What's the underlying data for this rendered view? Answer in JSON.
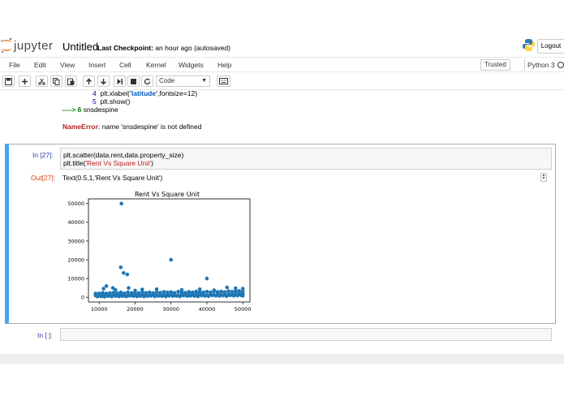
{
  "header": {
    "logo_text": "jupyter",
    "notebook_title": "Untitled",
    "checkpoint_label": "Last Checkpoint:",
    "checkpoint_time": "an hour ago",
    "autosave": "(autosaved)",
    "logout_label": "Logout"
  },
  "menubar": {
    "items": [
      "File",
      "Edit",
      "View",
      "Insert",
      "Cell",
      "Kernel",
      "Widgets",
      "Help"
    ],
    "trusted_label": "Trusted",
    "kernel_name": "Python 3"
  },
  "toolbar": {
    "cell_type": "Code",
    "icons": [
      "save-icon",
      "plus-icon",
      "cut-icon",
      "copy-icon",
      "paste-icon",
      "arrow-up-icon",
      "arrow-down-icon",
      "step-forward-icon",
      "stop-icon",
      "refresh-icon",
      "keyboard-icon"
    ]
  },
  "prev_output": {
    "line4_no": "4",
    "line4_pre": "plt.xlabel(",
    "line4_str": "'latitude'",
    "line4_post": ",fontsize=12)",
    "line5_no": "5",
    "line5_code": "plt.show()",
    "arrow_line_marker": "----> 6",
    "arrow_line_code": "snsdespine",
    "error_name": "NameError",
    "error_msg": ": name 'snsdespine' is not defined"
  },
  "cell": {
    "in_prompt": "In [27]:",
    "code_line1": "plt.scatter(data.rent,data.property_size)",
    "code_line2_pre": "plt.title(",
    "code_line2_str": "'Rent Vs Square Unit'",
    "code_line2_post": ")",
    "out_prompt": "Out[27]:",
    "out_text": "Text(0.5,1,'Rent Vs Square Unit')"
  },
  "empty_cell": {
    "in_prompt": "In [ ]:"
  },
  "colors": {
    "accent": "#42a5f5",
    "in_prompt": "#303f9f",
    "out_prompt": "#d84315",
    "error": "#b22222",
    "marker": "#1f77b4"
  },
  "chart_data": {
    "type": "scatter",
    "title": "Rent Vs Square Unit",
    "xlim": [
      7000,
      52000
    ],
    "ylim": [
      -2500,
      52500
    ],
    "xticks": [
      10000,
      20000,
      30000,
      40000,
      50000
    ],
    "yticks": [
      0,
      10000,
      20000,
      30000,
      40000,
      50000
    ],
    "series": [
      {
        "color": "#1f77b4",
        "points": [
          [
            16200,
            50000
          ],
          [
            16000,
            16000
          ],
          [
            30000,
            20000
          ],
          [
            16800,
            13000
          ],
          [
            17800,
            12200
          ],
          [
            40000,
            10000
          ],
          [
            12000,
            6000
          ],
          [
            13800,
            5000
          ],
          [
            11200,
            4600
          ],
          [
            18200,
            5000
          ],
          [
            14500,
            4000
          ],
          [
            22000,
            4200
          ],
          [
            45600,
            5300
          ],
          [
            26000,
            4300
          ],
          [
            33000,
            4000
          ],
          [
            38000,
            4300
          ],
          [
            48000,
            4800
          ],
          [
            50000,
            4600
          ],
          [
            42000,
            3800
          ],
          [
            20000,
            3600
          ],
          [
            9000,
            2000
          ],
          [
            10000,
            2100
          ],
          [
            11000,
            2400
          ],
          [
            12000,
            2000
          ],
          [
            13000,
            2300
          ],
          [
            14000,
            2500
          ],
          [
            15000,
            2200
          ],
          [
            16000,
            2600
          ],
          [
            17000,
            2100
          ],
          [
            18000,
            2700
          ],
          [
            19000,
            2300
          ],
          [
            20000,
            2500
          ],
          [
            21000,
            2200
          ],
          [
            22000,
            2800
          ],
          [
            23000,
            2400
          ],
          [
            24000,
            2600
          ],
          [
            25000,
            2300
          ],
          [
            26000,
            2700
          ],
          [
            27000,
            2500
          ],
          [
            28000,
            2900
          ],
          [
            29000,
            2600
          ],
          [
            30000,
            2800
          ],
          [
            31000,
            2400
          ],
          [
            32000,
            3000
          ],
          [
            33000,
            2700
          ],
          [
            34000,
            2500
          ],
          [
            35000,
            2900
          ],
          [
            36000,
            2600
          ],
          [
            37000,
            3100
          ],
          [
            38000,
            2800
          ],
          [
            39000,
            2600
          ],
          [
            40000,
            3000
          ],
          [
            41000,
            2700
          ],
          [
            42000,
            3200
          ],
          [
            43000,
            2900
          ],
          [
            44000,
            3100
          ],
          [
            45000,
            2800
          ],
          [
            46000,
            3300
          ],
          [
            47000,
            3000
          ],
          [
            48000,
            3200
          ],
          [
            49000,
            3400
          ],
          [
            50000,
            3000
          ],
          [
            9000,
            900
          ],
          [
            10000,
            1100
          ],
          [
            11000,
            800
          ],
          [
            12000,
            1200
          ],
          [
            13000,
            1000
          ],
          [
            14000,
            1300
          ],
          [
            15000,
            900
          ],
          [
            16000,
            1400
          ],
          [
            17000,
            1100
          ],
          [
            18000,
            1000
          ],
          [
            19000,
            1300
          ],
          [
            20000,
            1200
          ],
          [
            21000,
            900
          ],
          [
            22000,
            1400
          ],
          [
            23000,
            1100
          ],
          [
            24000,
            1000
          ],
          [
            25000,
            1500
          ],
          [
            26000,
            1200
          ],
          [
            27000,
            1100
          ],
          [
            28000,
            1300
          ],
          [
            29000,
            1000
          ],
          [
            30000,
            1400
          ],
          [
            31000,
            1200
          ],
          [
            32000,
            1100
          ],
          [
            33000,
            1500
          ],
          [
            34000,
            1300
          ],
          [
            35000,
            1000
          ],
          [
            36000,
            1400
          ],
          [
            37000,
            1200
          ],
          [
            38000,
            1600
          ],
          [
            39000,
            1300
          ],
          [
            40000,
            1100
          ],
          [
            41000,
            1500
          ],
          [
            42000,
            1300
          ],
          [
            43000,
            1700
          ],
          [
            44000,
            1400
          ],
          [
            45000,
            1200
          ],
          [
            46000,
            1600
          ],
          [
            47000,
            1400
          ],
          [
            48000,
            1800
          ],
          [
            49000,
            1500
          ],
          [
            50000,
            1700
          ],
          [
            9500,
            400
          ],
          [
            10500,
            500
          ],
          [
            11500,
            300
          ],
          [
            12500,
            600
          ],
          [
            13500,
            400
          ],
          [
            14500,
            700
          ],
          [
            15500,
            500
          ],
          [
            16500,
            600
          ],
          [
            17500,
            400
          ],
          [
            18500,
            800
          ],
          [
            19500,
            600
          ],
          [
            20500,
            500
          ],
          [
            21500,
            700
          ],
          [
            22500,
            400
          ],
          [
            23500,
            600
          ],
          [
            24500,
            800
          ],
          [
            25500,
            500
          ],
          [
            26500,
            700
          ],
          [
            27500,
            600
          ],
          [
            28500,
            400
          ],
          [
            29500,
            800
          ],
          [
            30500,
            600
          ],
          [
            31500,
            700
          ],
          [
            32500,
            500
          ],
          [
            33500,
            900
          ],
          [
            34500,
            600
          ],
          [
            35500,
            800
          ],
          [
            36500,
            700
          ],
          [
            37500,
            500
          ],
          [
            38500,
            900
          ],
          [
            39500,
            700
          ],
          [
            40500,
            600
          ],
          [
            41500,
            1000
          ],
          [
            42500,
            800
          ],
          [
            43500,
            700
          ],
          [
            44500,
            900
          ],
          [
            45500,
            600
          ],
          [
            46500,
            1000
          ],
          [
            47500,
            800
          ],
          [
            48500,
            900
          ],
          [
            49500,
            1100
          ],
          [
            50000,
            800
          ],
          [
            9000,
            1700
          ],
          [
            11000,
            1600
          ],
          [
            13000,
            1800
          ],
          [
            15000,
            1700
          ],
          [
            17000,
            1900
          ],
          [
            19000,
            1800
          ],
          [
            21000,
            1700
          ],
          [
            23000,
            1900
          ],
          [
            25000,
            2000
          ],
          [
            27000,
            1800
          ],
          [
            29000,
            2000
          ],
          [
            31000,
            1900
          ],
          [
            33000,
            2100
          ],
          [
            35000,
            2000
          ],
          [
            37000,
            2200
          ],
          [
            39000,
            2100
          ],
          [
            41000,
            2300
          ],
          [
            43000,
            2200
          ],
          [
            45000,
            2400
          ],
          [
            47000,
            2300
          ],
          [
            49000,
            2500
          ]
        ]
      }
    ]
  }
}
